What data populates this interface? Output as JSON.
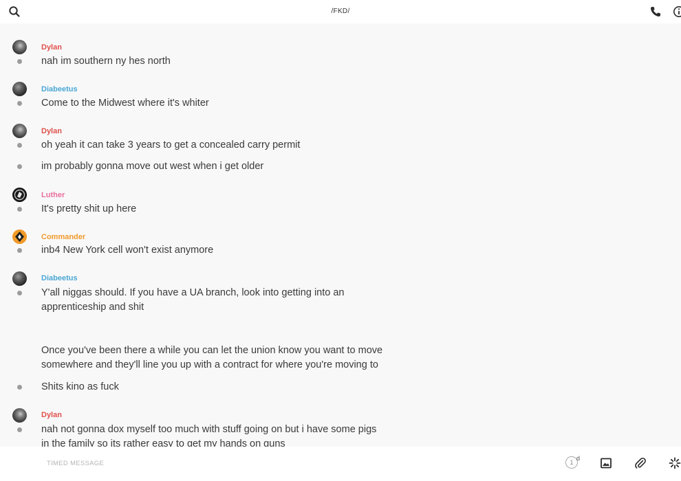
{
  "header": {
    "title": "/FKD/"
  },
  "messages": [
    {
      "sender": "Dylan",
      "text": "nah im southern ny hes north"
    },
    {
      "sender": "Diabeetus",
      "text": "Come to the Midwest where it's whiter"
    },
    {
      "sender": "Dylan",
      "text": "oh yeah it can take 3 years to get a concealed carry permit"
    },
    {
      "sender": "",
      "text": "im probably gonna move out west when i get older"
    },
    {
      "sender": "Luther",
      "text": "It's pretty shit up here"
    },
    {
      "sender": "Commander",
      "text": "inb4 New York cell won't exist anymore"
    },
    {
      "sender": "Diabeetus",
      "text": "Y'all niggas should. If you have a UA branch, look into getting into an apprenticeship and shit\n\n\nOnce you've been there a while you can let the union know you want to move somewhere and they'll line you up with a contract for where you're moving to"
    },
    {
      "sender": "",
      "text": "Shits kino as fuck"
    },
    {
      "sender": "Dylan",
      "text": "nah not gonna dox myself too much with stuff going on but i have some pigs in the family so its rather easy to get my hands on guns"
    }
  ],
  "colors": {
    "Dylan": "#e0514b",
    "Diabeetus": "#4aa7d4",
    "Luther": "#ea6f9a",
    "Commander": "#f09a2a"
  },
  "composer": {
    "placeholder": "TIMED MESSAGE",
    "timer_value": "1",
    "timer_unit": "d"
  },
  "icons": {
    "search": "search-icon",
    "call": "phone-icon",
    "info": "info-icon",
    "image": "image-icon",
    "attach": "paperclip-icon",
    "emoji": "sparkle-icon"
  }
}
